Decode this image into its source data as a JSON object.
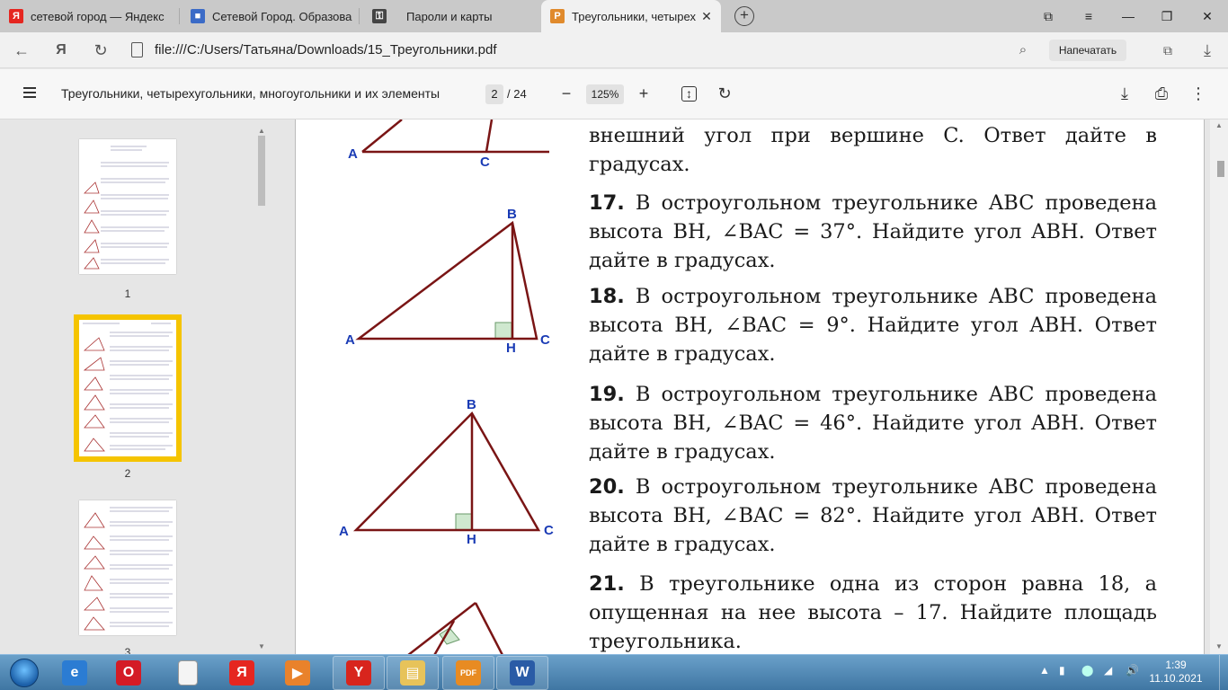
{
  "browser": {
    "tabs": [
      {
        "label": "сетевой город — Яндекс",
        "icon": "yandex-favicon",
        "color": "#e52620",
        "glyph": "Я"
      },
      {
        "label": "Сетевой Город. Образова",
        "icon": "school-favicon",
        "color": "#3b6bc7",
        "glyph": "■"
      },
      {
        "label": "Пароли и карты",
        "icon": "key-favicon",
        "color": "#444444",
        "glyph": "⚿"
      },
      {
        "label": "Треугольники, четырех",
        "icon": "pdf-favicon",
        "color": "#e08a2c",
        "glyph": "P"
      }
    ],
    "address": "file:///C:/Users/Татьяна/Downloads/15_Треугольники.pdf",
    "print_label": "Напечатать"
  },
  "pdf_toolbar": {
    "title": "Треугольники, четырехугольники, многоугольники и их элементы",
    "page_current": "2",
    "page_total": "/ 24",
    "zoom": "125%"
  },
  "thumbnails": [
    {
      "label": "1",
      "active": false
    },
    {
      "label": "2",
      "active": true
    },
    {
      "label": "3",
      "active": false
    }
  ],
  "figures": {
    "fig1": {
      "A": "A",
      "C": "C"
    },
    "fig2": {
      "A": "A",
      "B": "B",
      "C": "C",
      "H": "H"
    },
    "fig3": {
      "A": "A",
      "B": "B",
      "C": "C",
      "H": "H"
    }
  },
  "problems": [
    {
      "num": "",
      "text": "внешний угол при вершине C. Ответ дайте в градусах."
    },
    {
      "num": "17.",
      "text": "В остроугольном треугольнике ABC проведена высота BH, ∠BAC = 37°. Найдите угол ABH. Ответ дайте в градусах."
    },
    {
      "num": "18.",
      "text": "В остроугольном треугольнике ABC проведена высота BH, ∠BAC = 9°. Найдите угол ABH. Ответ дайте в градусах."
    },
    {
      "num": "19.",
      "text": "В остроугольном треугольнике ABC проведена высота BH, ∠BAC = 46°. Найдите угол ABH. Ответ дайте в градусах."
    },
    {
      "num": "20.",
      "text": "В остроугольном треугольнике ABC проведена высота BH, ∠BAC = 82°. Найдите угол ABH. Ответ дайте в градусах."
    },
    {
      "num": "21.",
      "text": "В треугольнике одна из сторон равна 18, а опущенная на нее высота – 17. Найдите площадь треугольника."
    }
  ],
  "colors": {
    "triangle_stroke": "#7a1515",
    "label_blue": "#1a3bb5",
    "right_angle_fill": "#cfe8cf",
    "active_thumb_outline": "#f5c400"
  },
  "taskbar": {
    "apps": [
      {
        "name": "internet-explorer-icon",
        "glyph": "e",
        "color": "#2b7cd3"
      },
      {
        "name": "opera-icon",
        "glyph": "O",
        "color": "#d41b26"
      },
      {
        "name": "blank-document-icon",
        "glyph": "",
        "color": "#f4f4f4"
      },
      {
        "name": "yandex-browser-icon",
        "glyph": "Я",
        "color": "#e52620"
      },
      {
        "name": "media-player-icon",
        "glyph": "▶",
        "color": "#e9822b"
      },
      {
        "name": "yandex-y-icon",
        "glyph": "Y",
        "color": "#d8251d"
      },
      {
        "name": "file-explorer-icon",
        "glyph": "▤",
        "color": "#e7c35a"
      },
      {
        "name": "pdf-app-icon",
        "glyph": "PDF",
        "color": "#e88b22"
      },
      {
        "name": "word-icon",
        "glyph": "W",
        "color": "#2a5ba6"
      }
    ],
    "time": "1:39",
    "date": "11.10.2021"
  }
}
